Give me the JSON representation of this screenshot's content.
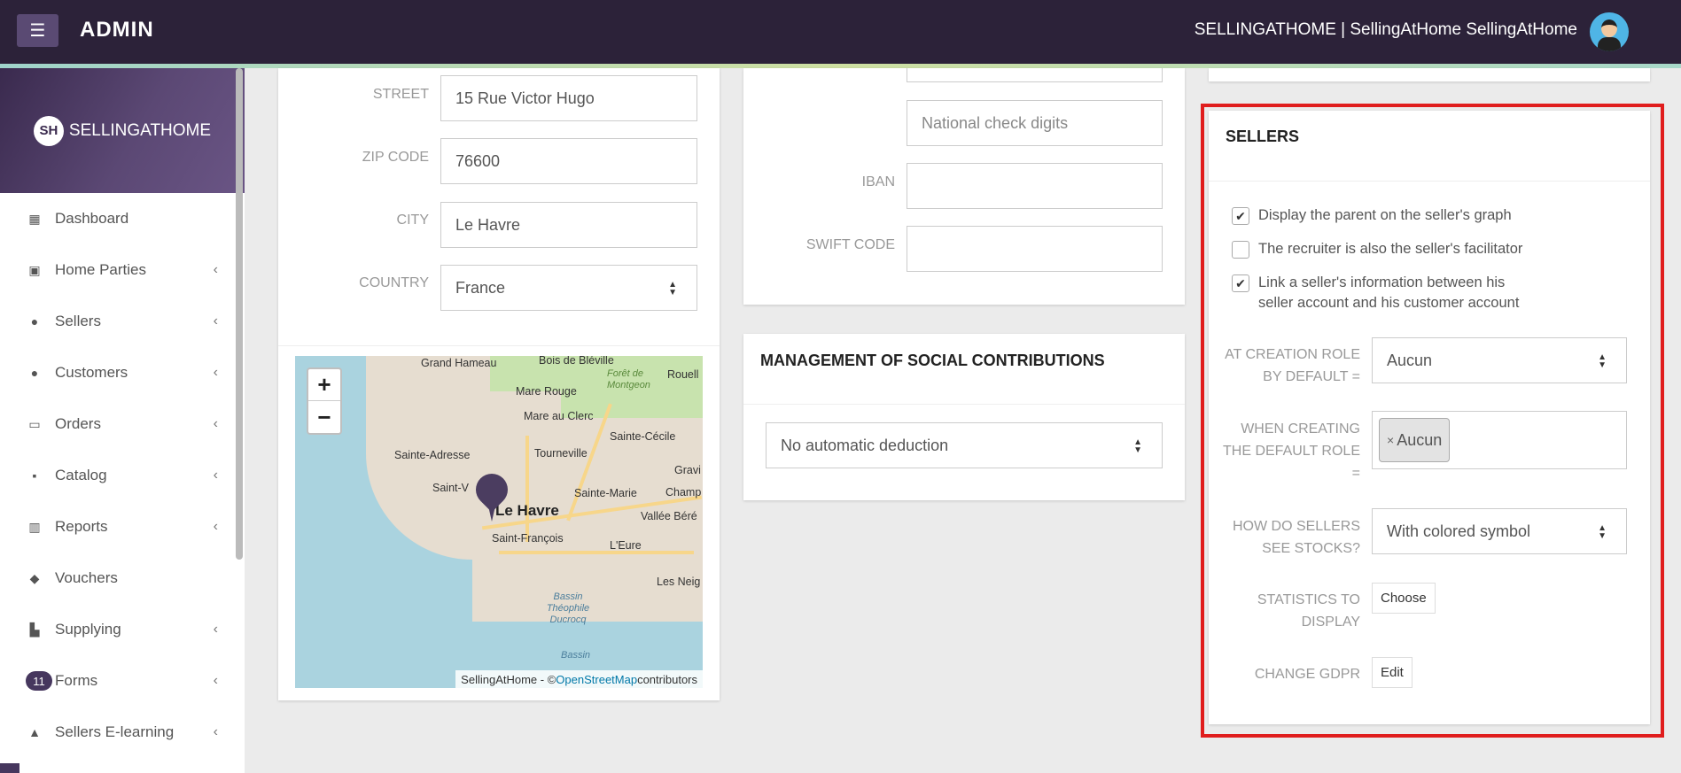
{
  "header": {
    "brand": "ADMIN",
    "user_text": "SELLINGATHOME | SellingAtHome SellingAtHome"
  },
  "sidebar": {
    "logo_initials": "SH",
    "logo_text": "SELLINGATHOME",
    "items": [
      {
        "label": "Dashboard",
        "icon": "dashboard-icon",
        "glyph": "▦",
        "chevron": false
      },
      {
        "label": "Home Parties",
        "icon": "calendar-icon",
        "glyph": "▣",
        "chevron": true
      },
      {
        "label": "Sellers",
        "icon": "users-icon",
        "glyph": "●",
        "chevron": true
      },
      {
        "label": "Customers",
        "icon": "users-icon",
        "glyph": "●",
        "chevron": true
      },
      {
        "label": "Orders",
        "icon": "credit-card-icon",
        "glyph": "▭",
        "chevron": true
      },
      {
        "label": "Catalog",
        "icon": "archive-icon",
        "glyph": "▪",
        "chevron": true
      },
      {
        "label": "Reports",
        "icon": "bar-chart-icon",
        "glyph": "▥",
        "chevron": true
      },
      {
        "label": "Vouchers",
        "icon": "tags-icon",
        "glyph": "◆",
        "chevron": false
      },
      {
        "label": "Supplying",
        "icon": "industry-icon",
        "glyph": "▙",
        "chevron": true
      },
      {
        "label": "Forms",
        "icon": "",
        "glyph": "",
        "chevron": true,
        "badge": "11"
      },
      {
        "label": "Sellers E-learning",
        "icon": "graduation-cap-icon",
        "glyph": "▲",
        "chevron": true
      }
    ]
  },
  "address": {
    "street_label": "STREET",
    "street_value": "15 Rue Victor Hugo",
    "zip_label": "ZIP CODE",
    "zip_value": "76600",
    "city_label": "CITY",
    "city_value": "Le Havre",
    "country_label": "COUNTRY",
    "country_value": "France"
  },
  "map": {
    "zoom_in": "+",
    "zoom_out": "−",
    "labels": {
      "grand_hameau": "Grand Hameau",
      "bois_de_bleville": "Bois de Bléville",
      "foret_de_montgeon": "Forêt de Montgeon",
      "rouelles": "Rouell",
      "mare_rouge": "Mare Rouge",
      "mare_au_clerc": "Mare au Clerc",
      "sainte_cecile": "Sainte-Cécile",
      "sainte_adresse": "Sainte-Adresse",
      "tourneville": "Tourneville",
      "graville": "Gravi",
      "saint_vincent": "Saint-V",
      "sainte_marie": "Sainte-Marie",
      "champ": "Champ",
      "le_havre": "Le Havre",
      "vallee_bereult": "Vallée Béré",
      "saint_francois": "Saint-François",
      "l_eure": "L'Eure",
      "les_neiges": "Les Neig",
      "bassin_theophile": "Bassin Théophile Ducrocq",
      "bassin_2": "Bassin"
    },
    "attribution_prefix": "SellingAtHome - © ",
    "attribution_link": "OpenStreetMap",
    "attribution_suffix": " contributors"
  },
  "bank": {
    "national_check_placeholder": "National check digits",
    "iban_label": "IBAN",
    "iban_value": "",
    "swift_label": "SWIFT CODE",
    "swift_value": ""
  },
  "social": {
    "title": "MANAGEMENT OF SOCIAL CONTRIBUTIONS",
    "selected": "No automatic deduction"
  },
  "sellers": {
    "title": "SELLERS",
    "checkboxes": [
      {
        "label": "Display the parent on the seller's graph",
        "checked": true
      },
      {
        "label": "The recruiter is also the seller's facilitator",
        "checked": false
      },
      {
        "label_line1": "Link a seller's information between his",
        "label_line2": "seller account and his customer account",
        "checked": true
      }
    ],
    "creation_role_label_1": "AT CREATION ROLE",
    "creation_role_label_2": "BY DEFAULT =",
    "creation_role_value": "Aucun",
    "default_role_label_1": "WHEN CREATING",
    "default_role_label_2": "THE DEFAULT ROLE",
    "default_role_label_3": "=",
    "default_role_tag": "Aucun",
    "stocks_label_1": "HOW DO SELLERS",
    "stocks_label_2": "SEE STOCKS?",
    "stocks_value": "With colored symbol",
    "stats_label_1": "STATISTICS TO",
    "stats_label_2": "DISPLAY",
    "stats_button": "Choose",
    "gdpr_label": "CHANGE GDPR",
    "gdpr_button": "Edit"
  },
  "colors": {
    "topbar": "#2c2239",
    "accent": "#46375e",
    "highlight": "#e01d1d"
  }
}
